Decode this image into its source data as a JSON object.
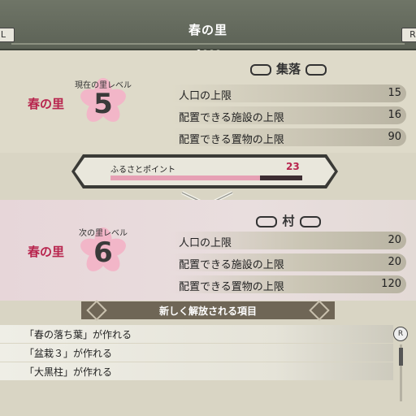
{
  "header": {
    "title": "春の里",
    "left_button": "L",
    "right_button": "R",
    "page_dots": 4,
    "active_dot": 0
  },
  "current": {
    "village_name": "春の里",
    "level_label": "現在の里レベル",
    "level": "5",
    "section_title": "集落",
    "stats": [
      {
        "label": "人口の上限",
        "value": "15"
      },
      {
        "label": "配置できる施設の上限",
        "value": "16"
      },
      {
        "label": "配置できる置物の上限",
        "value": "90"
      }
    ]
  },
  "points": {
    "label": "ふるさとポイント",
    "value": "23",
    "fill_fraction": 0.78
  },
  "next": {
    "village_name": "春の里",
    "level_label": "次の里レベル",
    "level": "6",
    "section_title": "村",
    "stats": [
      {
        "label": "人口の上限",
        "value": "20"
      },
      {
        "label": "配置できる施設の上限",
        "value": "20"
      },
      {
        "label": "配置できる置物の上限",
        "value": "120"
      }
    ]
  },
  "unlock": {
    "title": "新しく解放される項目",
    "items": [
      "「春の落ち葉」が作れる",
      "「盆栽３」が作れる",
      "「大黒柱」が作れる"
    ]
  },
  "scroll_button": "R",
  "colors": {
    "accent_pink": "#b8254e",
    "bar_fill": "#e6a0b4",
    "header_bg": "#6f7567"
  }
}
